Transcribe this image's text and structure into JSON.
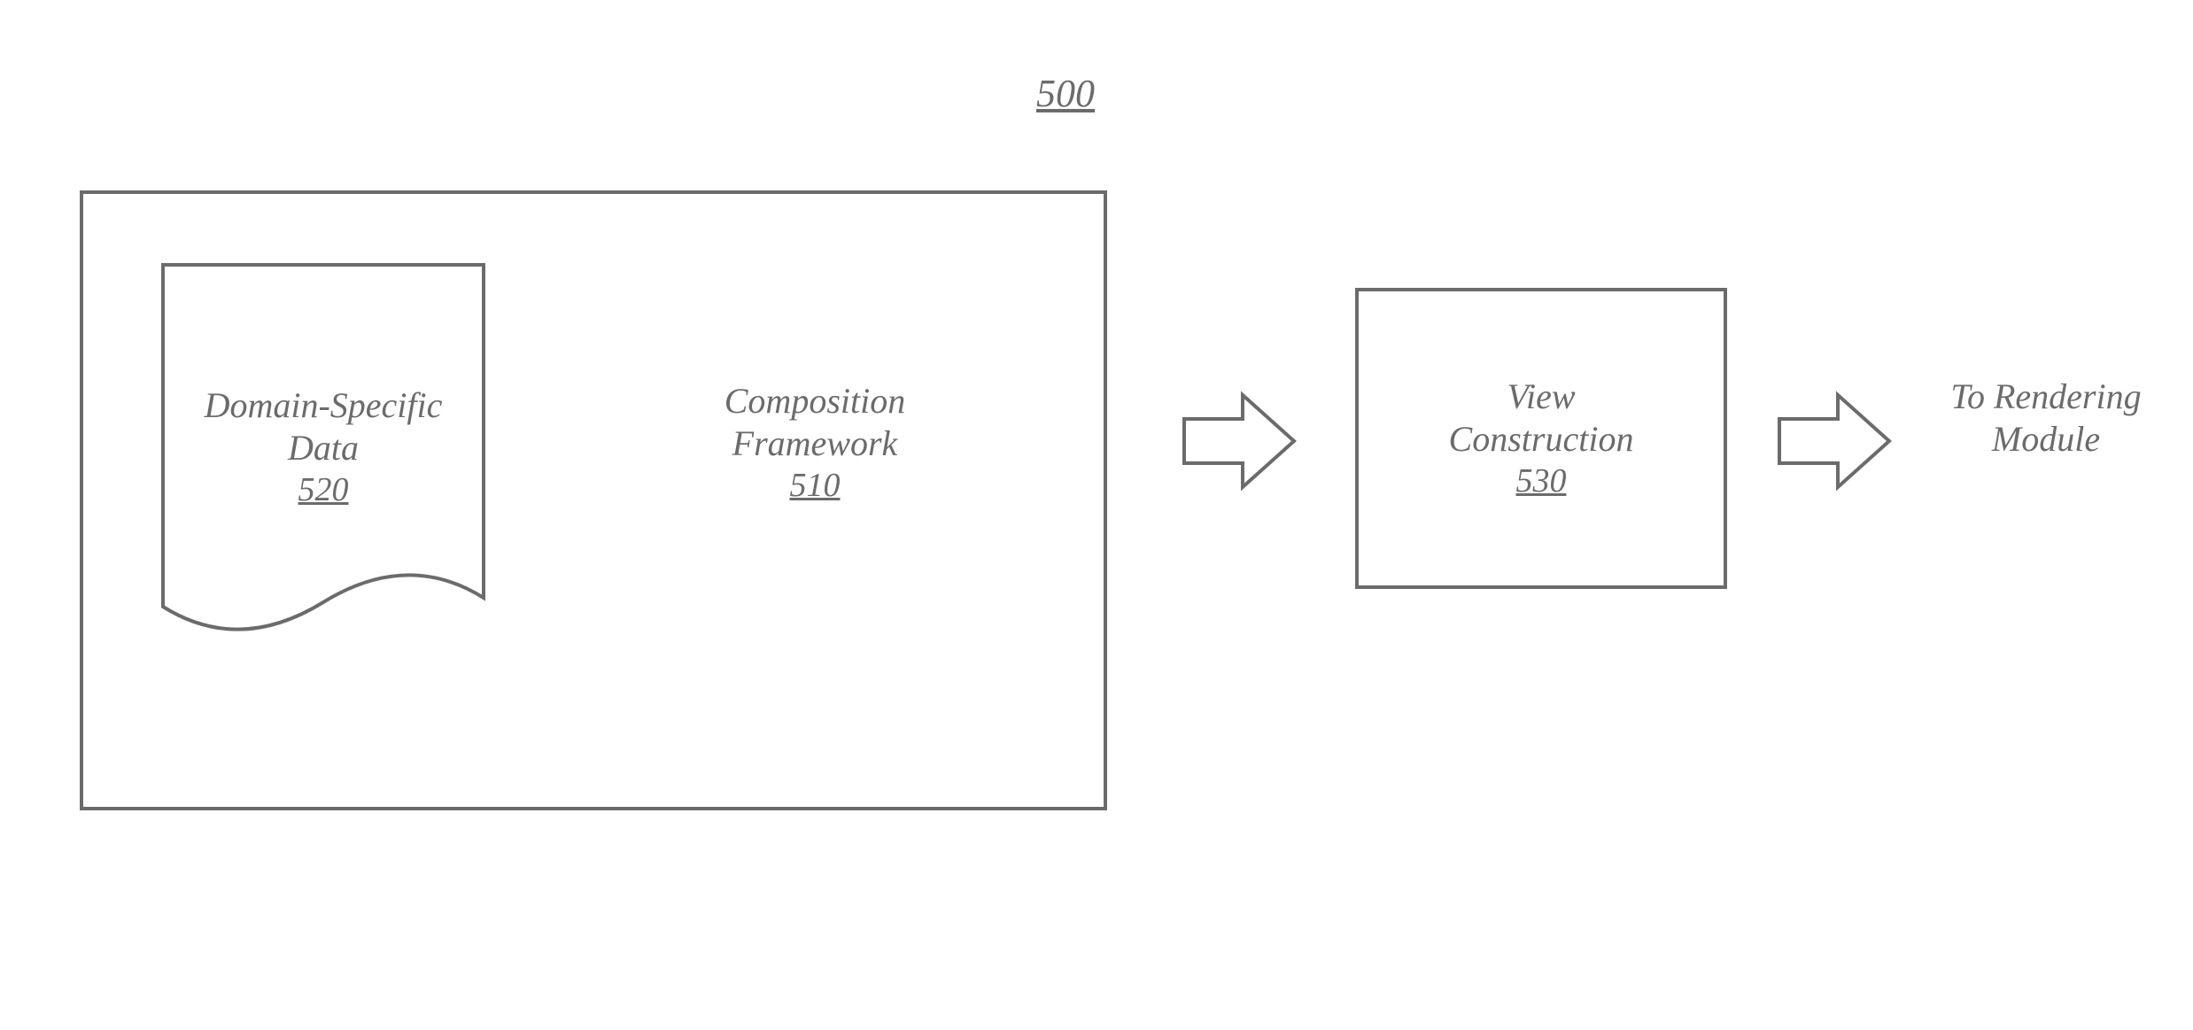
{
  "figure_number": "500",
  "outer": {
    "doc": {
      "line1": "Domain-Specific",
      "line2": "Data",
      "ref": "520"
    },
    "comp": {
      "line1": "Composition",
      "line2": "Framework",
      "ref": "510"
    }
  },
  "view": {
    "line1": "View",
    "line2": "Construction",
    "ref": "530"
  },
  "rendering": {
    "line1": "To Rendering",
    "line2": "Module"
  }
}
